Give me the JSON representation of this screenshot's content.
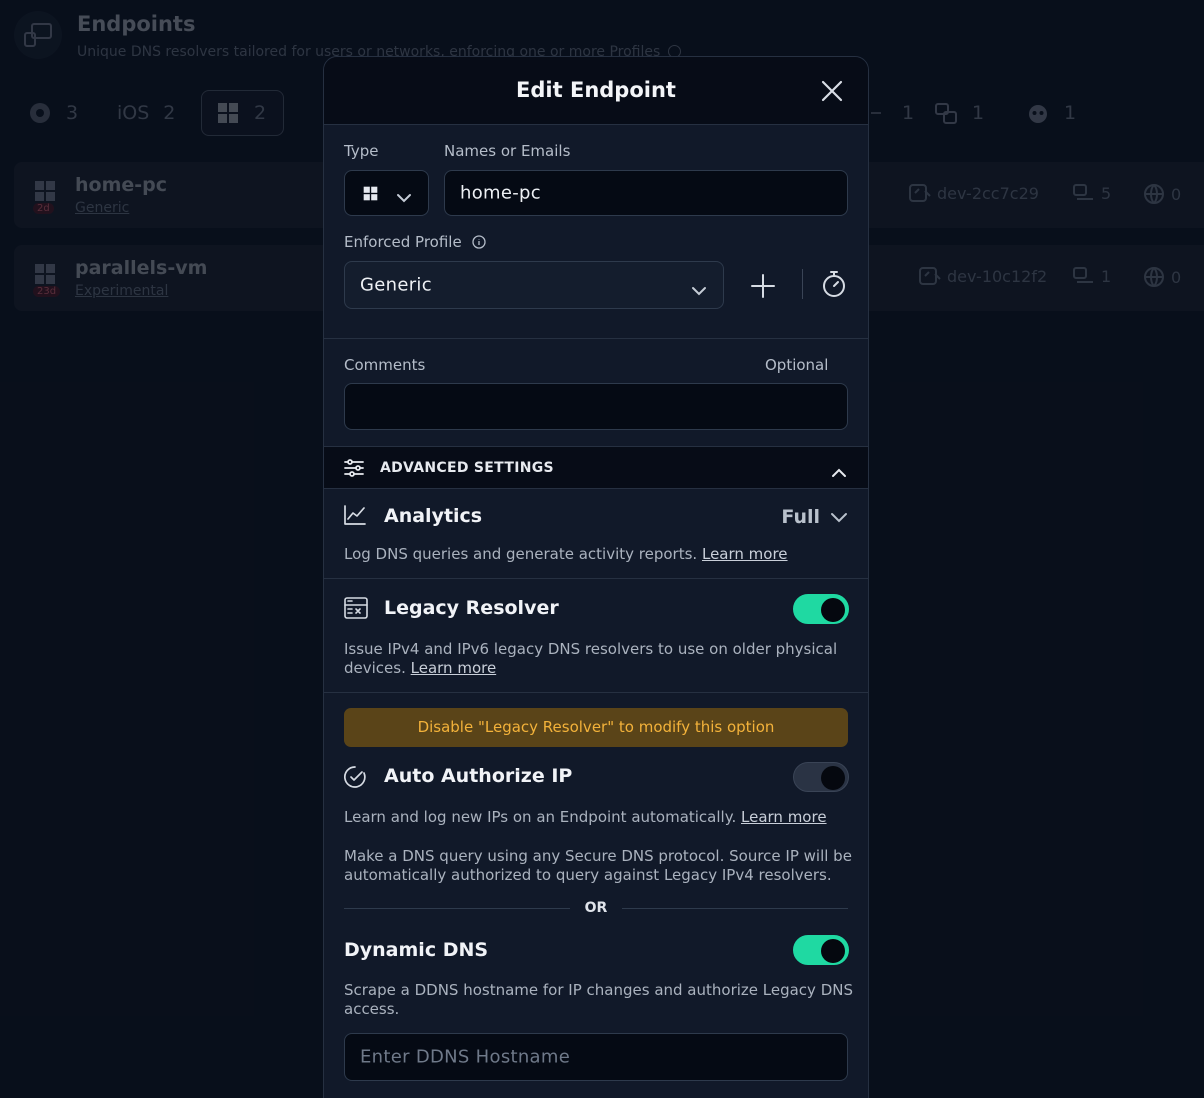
{
  "background": {
    "title": "Endpoints",
    "subtitle": "Unique DNS resolvers tailored for users or networks, enforcing one or more Profiles",
    "filters": [
      {
        "icon": "chrome-icon",
        "count": "3"
      },
      {
        "label": "iOS",
        "count": "2"
      },
      {
        "icon": "windows-icon",
        "count": "2",
        "active": true
      },
      {
        "icon": "router-icon",
        "count": "1"
      },
      {
        "icon": "device-group-icon",
        "count": "1"
      },
      {
        "icon": "mascot-icon",
        "count": "1"
      }
    ],
    "rows": [
      {
        "name": "home-pc",
        "profile": "Generic",
        "age": "2d",
        "device_id": "dev-2cc7c29",
        "devices": "5",
        "ips": "0"
      },
      {
        "name": "parallels-vm",
        "profile": "Experimental",
        "age": "23d",
        "device_id": "dev-10c12f2",
        "devices": "1",
        "ips": "0"
      }
    ]
  },
  "modal": {
    "title": "Edit Endpoint",
    "type_label": "Type",
    "names_label": "Names or Emails",
    "names_value": "home-pc",
    "profile_label": "Enforced Profile",
    "profile_value": "Generic",
    "comments_label": "Comments",
    "comments_optional": "Optional",
    "comments_value": "",
    "advanced_label": "ADVANCED SETTINGS",
    "analytics": {
      "title": "Analytics",
      "value": "Full",
      "desc": "Log DNS queries and generate activity reports.",
      "link": "Learn more"
    },
    "legacy": {
      "title": "Legacy Resolver",
      "enabled": true,
      "desc_line1": "Issue IPv4 and IPv6 legacy DNS resolvers to use on older physical",
      "desc_line2": "devices.",
      "link": "Learn more"
    },
    "warning": "Disable \"Legacy Resolver\" to modify this option",
    "auto_auth": {
      "title": "Auto Authorize IP",
      "enabled": false,
      "desc": "Learn and log new IPs on an Endpoint automatically.",
      "link": "Learn more",
      "note_line1": "Make a DNS query using any Secure DNS protocol. Source IP will be",
      "note_line2": "automatically authorized to query against Legacy IPv4 resolvers."
    },
    "or_text": "OR",
    "ddns": {
      "title": "Dynamic DNS",
      "enabled": true,
      "desc_line1": "Scrape a DDNS hostname for IP changes and authorize Legacy DNS",
      "desc_line2": "access.",
      "placeholder": "Enter DDNS Hostname"
    }
  },
  "colors": {
    "accent": "#1fd9a2",
    "warning_bg": "#5a4418",
    "warning_text": "#f3b23a",
    "danger_badge": "#ff6f82"
  }
}
